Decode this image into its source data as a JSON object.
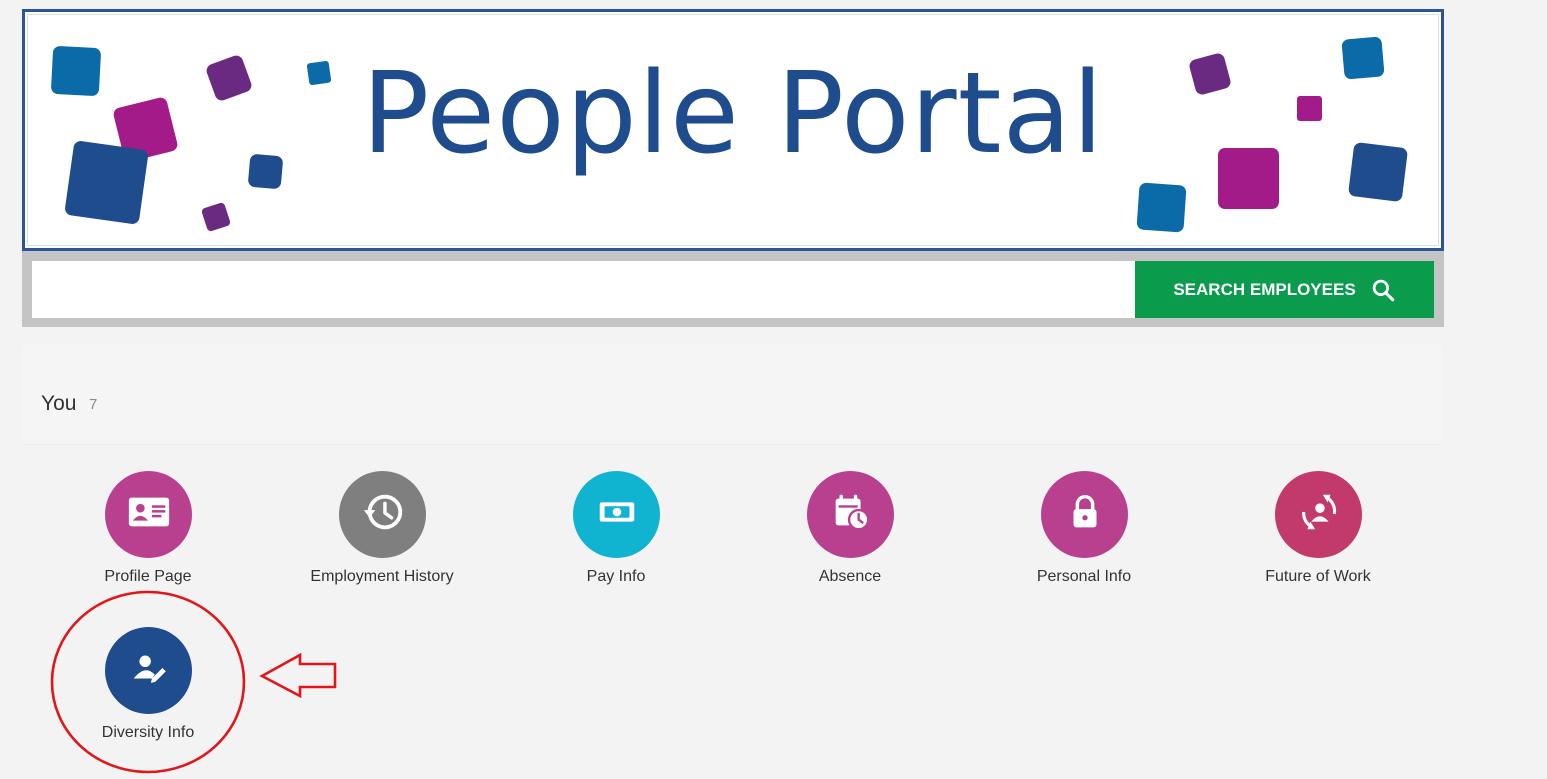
{
  "banner": {
    "title": "People Portal",
    "border_color": "#2b5597",
    "title_color": "#1e4c8c",
    "decoration_colors": [
      "#0b6aa8",
      "#a31b88",
      "#6a2a82",
      "#1e4c8c"
    ]
  },
  "search": {
    "input_value": "",
    "placeholder": "",
    "button_label": "SEARCH EMPLOYEES",
    "button_icon": "search-icon",
    "button_color": "#0a9b4d"
  },
  "section": {
    "title": "You",
    "count": "7"
  },
  "tiles": [
    {
      "label": "Profile Page",
      "icon": "id-card-icon",
      "color": "#b8408e"
    },
    {
      "label": "Employment History",
      "icon": "history-icon",
      "color": "#7f7f7f"
    },
    {
      "label": "Pay Info",
      "icon": "money-icon",
      "color": "#10b4d0"
    },
    {
      "label": "Absence",
      "icon": "calendar-clock-icon",
      "color": "#b8408e"
    },
    {
      "label": "Personal Info",
      "icon": "lock-icon",
      "color": "#b8408e"
    },
    {
      "label": "Future of Work",
      "icon": "person-arrows-icon",
      "color": "#c23a6b"
    },
    {
      "label": "Diversity Info",
      "icon": "person-edit-icon",
      "color": "#1e4c8c"
    }
  ],
  "annotation": {
    "circle_color": "#e0161b",
    "arrow_color": "#e0161b"
  }
}
